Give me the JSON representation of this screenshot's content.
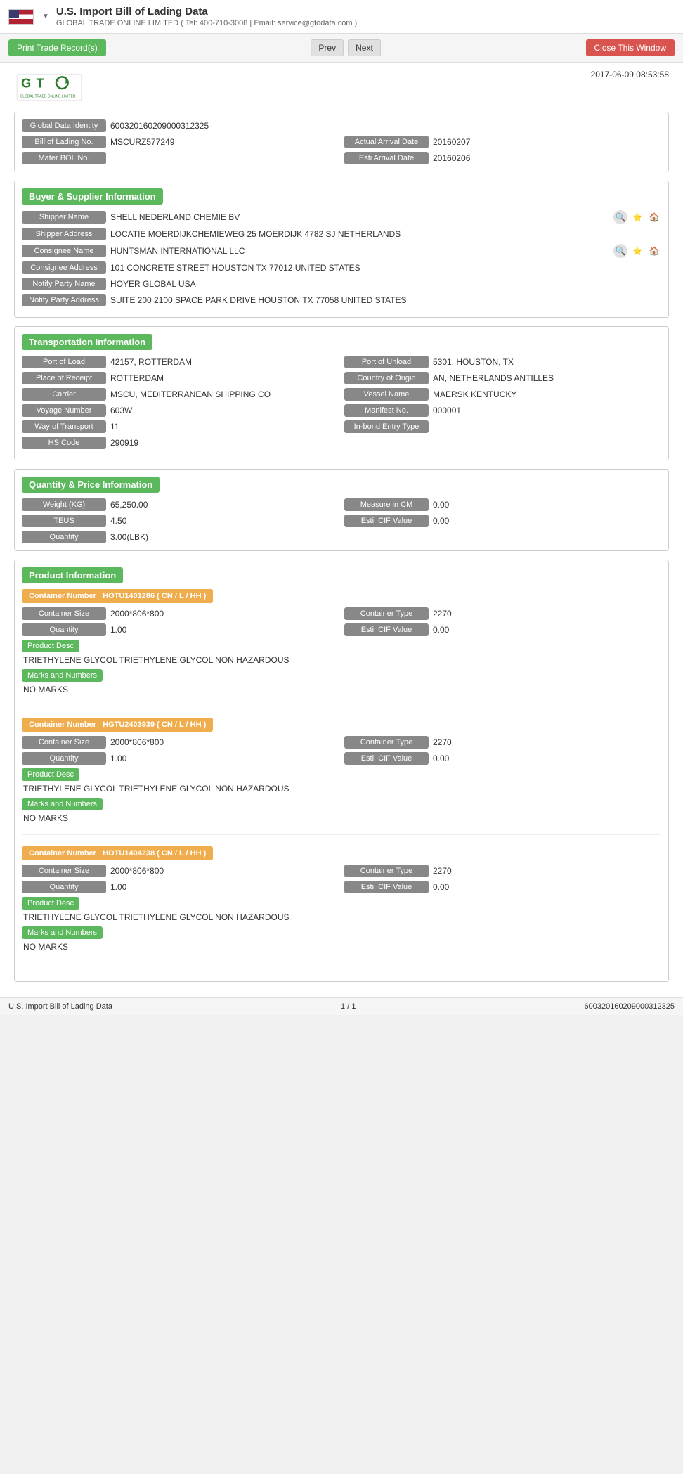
{
  "appTitle": "U.S. Import Bill of Lading Data",
  "companyInfo": "GLOBAL TRADE ONLINE LIMITED ( Tel: 400-710-3008 | Email: service@gtodata.com )",
  "toolbar": {
    "print_label": "Print Trade Record(s)",
    "prev_label": "Prev",
    "next_label": "Next",
    "close_label": "Close This Window"
  },
  "timestamp": "2017-06-09 08:53:58",
  "identity": {
    "label": "Global Data Identity",
    "value": "600320160209000312325"
  },
  "bol": {
    "label": "Bill of Lading No.",
    "value": "MSCURZ577249"
  },
  "actual_arrival": {
    "label": "Actual Arrival Date",
    "value": "20160207"
  },
  "mater_bol": {
    "label": "Mater BOL No.",
    "value": ""
  },
  "esti_arrival": {
    "label": "Esti Arrival Date",
    "value": "20160206"
  },
  "buyer_supplier": {
    "section_title": "Buyer & Supplier Information",
    "shipper_name_label": "Shipper Name",
    "shipper_name_value": "SHELL NEDERLAND CHEMIE BV",
    "shipper_address_label": "Shipper Address",
    "shipper_address_value": "LOCATIE MOERDIJKCHEMIEWEG 25 MOERDIJK 4782 SJ NETHERLANDS",
    "consignee_name_label": "Consignee Name",
    "consignee_name_value": "HUNTSMAN INTERNATIONAL LLC",
    "consignee_address_label": "Consignee Address",
    "consignee_address_value": "101 CONCRETE STREET HOUSTON TX 77012 UNITED STATES",
    "notify_party_name_label": "Notify Party Name",
    "notify_party_name_value": "HOYER GLOBAL USA",
    "notify_party_address_label": "Notify Party Address",
    "notify_party_address_value": "SUITE 200 2100 SPACE PARK DRIVE HOUSTON TX 77058 UNITED STATES"
  },
  "transportation": {
    "section_title": "Transportation Information",
    "port_of_load_label": "Port of Load",
    "port_of_load_value": "42157, ROTTERDAM",
    "port_of_unload_label": "Port of Unload",
    "port_of_unload_value": "5301, HOUSTON, TX",
    "place_of_receipt_label": "Place of Receipt",
    "place_of_receipt_value": "ROTTERDAM",
    "country_of_origin_label": "Country of Origin",
    "country_of_origin_value": "AN, NETHERLANDS ANTILLES",
    "carrier_label": "Carrier",
    "carrier_value": "MSCU, MEDITERRANEAN SHIPPING CO",
    "vessel_name_label": "Vessel Name",
    "vessel_name_value": "MAERSK KENTUCKY",
    "voyage_number_label": "Voyage Number",
    "voyage_number_value": "603W",
    "manifest_no_label": "Manifest No.",
    "manifest_no_value": "000001",
    "way_of_transport_label": "Way of Transport",
    "way_of_transport_value": "11",
    "in_bond_entry_label": "In-bond Entry Type",
    "in_bond_entry_value": "",
    "hs_code_label": "HS Code",
    "hs_code_value": "290919"
  },
  "quantity_price": {
    "section_title": "Quantity & Price Information",
    "weight_label": "Weight (KG)",
    "weight_value": "65,250.00",
    "measure_cm_label": "Measure in CM",
    "measure_cm_value": "0.00",
    "teus_label": "TEUS",
    "teus_value": "4.50",
    "esti_cif_label": "Esti. CIF Value",
    "esti_cif_value": "0.00",
    "quantity_label": "Quantity",
    "quantity_value": "3.00(LBK)"
  },
  "product_info": {
    "section_title": "Product Information",
    "containers": [
      {
        "container_number_label": "Container Number",
        "container_number_value": "HOTU1401286 ( CN / L / HH )",
        "container_size_label": "Container Size",
        "container_size_value": "2000*806*800",
        "container_type_label": "Container Type",
        "container_type_value": "2270",
        "quantity_label": "Quantity",
        "quantity_value": "1.00",
        "esti_cif_label": "Esti. CIF Value",
        "esti_cif_value": "0.00",
        "product_desc_label": "Product Desc",
        "product_desc_value": "TRIETHYLENE GLYCOL TRIETHYLENE GLYCOL NON HAZARDOUS",
        "marks_label": "Marks and Numbers",
        "marks_value": "NO MARKS"
      },
      {
        "container_number_label": "Container Number",
        "container_number_value": "HGTU2403939 ( CN / L / HH )",
        "container_size_label": "Container Size",
        "container_size_value": "2000*806*800",
        "container_type_label": "Container Type",
        "container_type_value": "2270",
        "quantity_label": "Quantity",
        "quantity_value": "1.00",
        "esti_cif_label": "Esti. CIF Value",
        "esti_cif_value": "0.00",
        "product_desc_label": "Product Desc",
        "product_desc_value": "TRIETHYLENE GLYCOL TRIETHYLENE GLYCOL NON HAZARDOUS",
        "marks_label": "Marks and Numbers",
        "marks_value": "NO MARKS"
      },
      {
        "container_number_label": "Container Number",
        "container_number_value": "HOTU1404238 ( CN / L / HH )",
        "container_size_label": "Container Size",
        "container_size_value": "2000*806*800",
        "container_type_label": "Container Type",
        "container_type_value": "2270",
        "quantity_label": "Quantity",
        "quantity_value": "1.00",
        "esti_cif_label": "Esti. CIF Value",
        "esti_cif_value": "0.00",
        "product_desc_label": "Product Desc",
        "product_desc_value": "TRIETHYLENE GLYCOL TRIETHYLENE GLYCOL NON HAZARDOUS",
        "marks_label": "Marks and Numbers",
        "marks_value": "NO MARKS"
      }
    ]
  },
  "footer": {
    "left_text": "U.S. Import Bill of Lading Data",
    "center_text": "1 / 1",
    "right_text": "600320160209000312325"
  }
}
